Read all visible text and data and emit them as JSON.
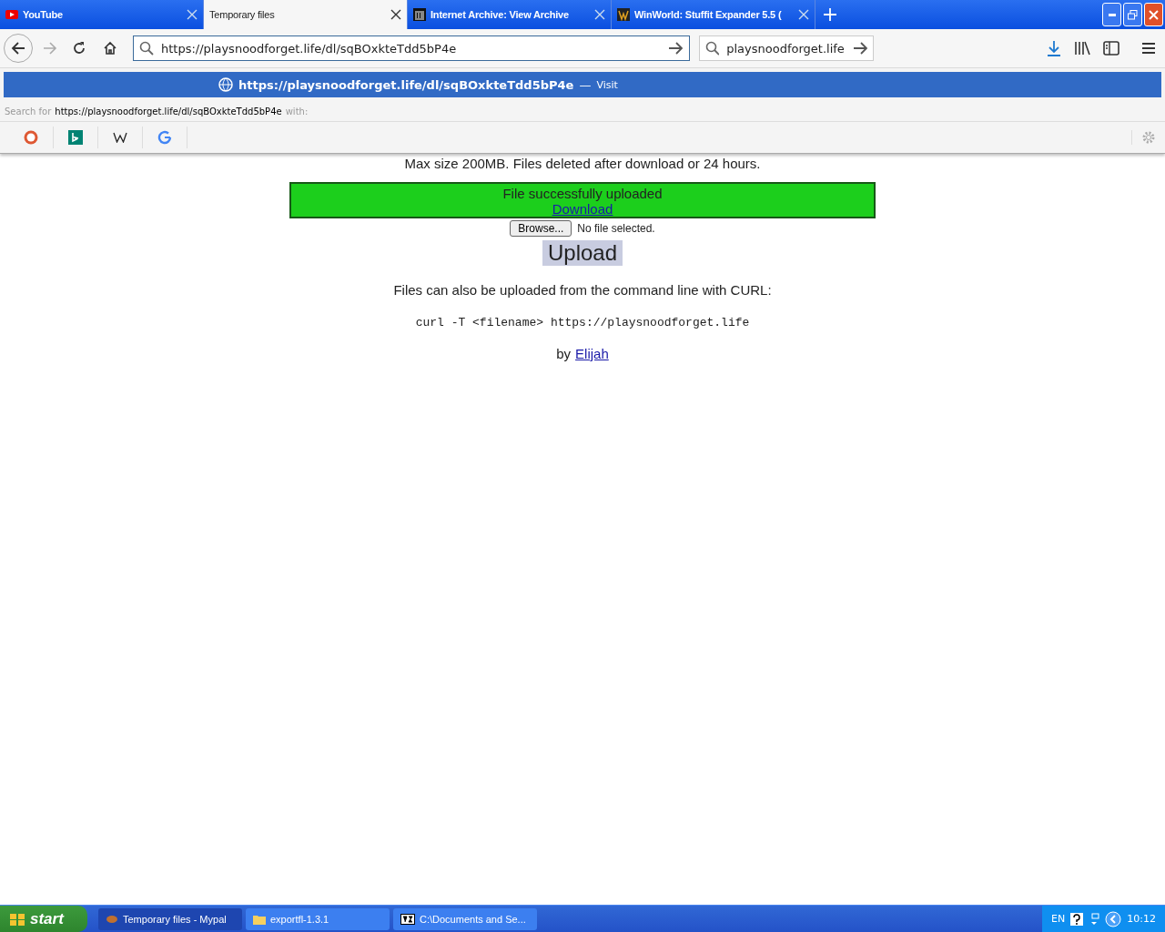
{
  "tabs": [
    {
      "title": "YouTube",
      "selected": false
    },
    {
      "title": "Temporary files",
      "selected": true
    },
    {
      "title": "Internet Archive: View Archive",
      "selected": false
    },
    {
      "title": "WinWorld: Stuffit Expander 5.5 (",
      "selected": false
    }
  ],
  "address_bar": {
    "value": "https://playsnoodforget.life/dl/sqBOxkteTdd5bP4e"
  },
  "search_field": {
    "value": "playsnoodforget.life"
  },
  "url_dropdown": {
    "url": "https://playsnoodforget.life/dl/sqBOxkteTdd5bP4e",
    "separator": "—",
    "action": "Visit",
    "search_prefix": "Search for",
    "search_query": "https://playsnoodforget.life/dl/sqBOxkteTdd5bP4e",
    "search_suffix": "with:"
  },
  "page": {
    "notice": "Max size 200MB. Files deleted after download or 24 hours.",
    "success_message": "File successfully uploaded",
    "download_link": "Download",
    "browse_button": "Browse...",
    "file_status": "No file selected.",
    "upload_button": "Upload",
    "curl_intro": "Files can also be uploaded from the command line with CURL:",
    "curl_command": "curl -T <filename> https://playsnoodforget.life",
    "byline": "by",
    "author_link": "Elijah"
  },
  "taskbar": {
    "start": "start",
    "items": [
      {
        "label": "Temporary files - Mypal",
        "selected": true
      },
      {
        "label": "exportfl-1.3.1",
        "selected": false
      },
      {
        "label": "C:\\Documents and Se...",
        "selected": false
      }
    ],
    "language": "EN",
    "clock": "10:12"
  }
}
